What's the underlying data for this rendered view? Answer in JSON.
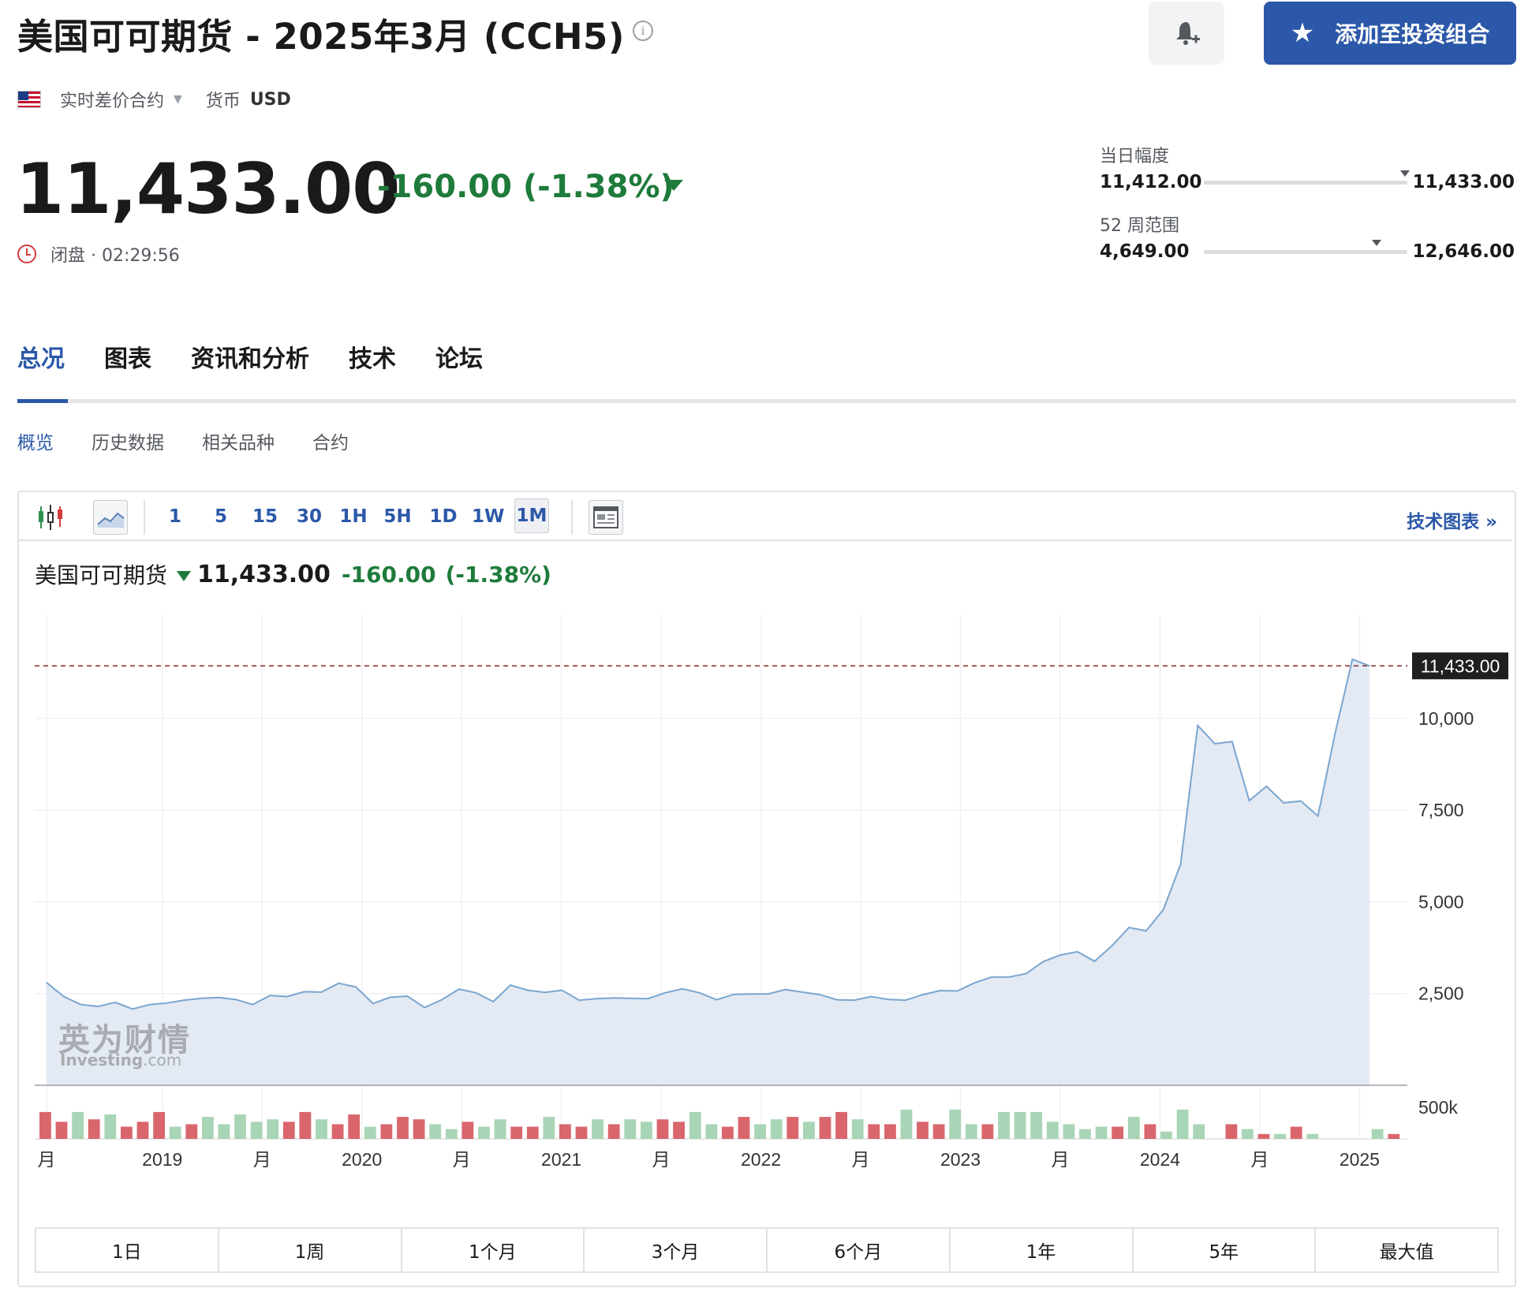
{
  "header": {
    "title": "美国可可期货 - 2025年3月 (CCH5)",
    "info_symbol": "i",
    "alert_icon": "bell-plus-icon",
    "add_button_label": "添加至投资组合",
    "add_button_icon": "star-icon"
  },
  "meta": {
    "flag": "us-flag-icon",
    "contract_type": "实时差价合约",
    "currency_label": "货币",
    "currency_value": "USD"
  },
  "quote": {
    "price": "11,433.00",
    "change": "-160.00 (-1.38%)",
    "direction": "down",
    "status": "闭盘 · 02:29:56",
    "up_color": "#1e7b3b"
  },
  "ranges": {
    "day_label": "当日幅度",
    "day_low": "11,412.00",
    "day_high": "11,433.00",
    "day_position": 0.99,
    "week52_label": "52 周范围",
    "week52_low": "4,649.00",
    "week52_high": "12,646.00",
    "week52_position": 0.85
  },
  "tabs": [
    "总况",
    "图表",
    "资讯和分析",
    "技术",
    "论坛"
  ],
  "active_tab": "总况",
  "subtabs": [
    "概览",
    "历史数据",
    "相关品种",
    "合约"
  ],
  "active_subtab": "概览",
  "toolbar": {
    "intervals": [
      "1",
      "5",
      "15",
      "30",
      "1H",
      "5H",
      "1D",
      "1W",
      "1M"
    ],
    "active_interval": "1M",
    "tech_chart_link": "技术图表 »"
  },
  "chart_header": {
    "name": "美国可可期货",
    "price": "11,433.00",
    "change": "-160.00",
    "change_pct": "(-1.38%)"
  },
  "watermark": {
    "cn": "英为财情",
    "en": "Investing",
    "en_suffix": ".com"
  },
  "chart_data": {
    "type": "area",
    "x_tick_labels": [
      "月",
      "2019",
      "月",
      "2020",
      "月",
      "2021",
      "月",
      "2022",
      "月",
      "2023",
      "月",
      "2024",
      "月",
      "2025"
    ],
    "x_tick_dates": [
      2018.42,
      2019.0,
      2019.5,
      2020.0,
      2020.5,
      2021.0,
      2021.5,
      2022.0,
      2022.5,
      2023.0,
      2023.5,
      2024.0,
      2024.5,
      2025.0
    ],
    "y_ticks": [
      2500,
      5000,
      7500,
      10000
    ],
    "y_tick_labels": [
      "2,500",
      "5,000",
      "7,500",
      "10,000"
    ],
    "ylim": [
      0,
      12600
    ],
    "current_price_label": "11,433.00",
    "current_price": 11433,
    "volume_tick_label": "500k",
    "line_color": "#7aa6cf",
    "fill_color": "#e3eaf4",
    "volume_up_color": "#a8d5b5",
    "volume_down_color": "#d9666c",
    "series": [
      {
        "values": [
          2800,
          2420,
          2200,
          2150,
          2260,
          2080,
          2200,
          2240,
          2320,
          2370,
          2390,
          2340,
          2200,
          2450,
          2420,
          2550,
          2540,
          2780,
          2680,
          2230,
          2400,
          2430,
          2120,
          2330,
          2620,
          2520,
          2280,
          2730,
          2590,
          2530,
          2590,
          2320,
          2360,
          2380,
          2370,
          2360,
          2520,
          2630,
          2520,
          2330,
          2480,
          2490,
          2490,
          2610,
          2540,
          2470,
          2330,
          2320,
          2420,
          2340,
          2320,
          2470,
          2580,
          2570,
          2790,
          2950,
          2950,
          3040,
          3370,
          3550,
          3640,
          3380,
          3800,
          4300,
          4210,
          4790,
          6020,
          9810,
          9310,
          9370,
          7760,
          8150,
          7700,
          7750,
          7340,
          9600,
          11610,
          11433
        ]
      }
    ],
    "volume": [
      {
        "v": 0.55,
        "up": false
      },
      {
        "v": 0.35,
        "up": false
      },
      {
        "v": 0.55,
        "up": true
      },
      {
        "v": 0.4,
        "up": false
      },
      {
        "v": 0.5,
        "up": true
      },
      {
        "v": 0.25,
        "up": false
      },
      {
        "v": 0.35,
        "up": false
      },
      {
        "v": 0.55,
        "up": false
      },
      {
        "v": 0.25,
        "up": true
      },
      {
        "v": 0.3,
        "up": false
      },
      {
        "v": 0.45,
        "up": true
      },
      {
        "v": 0.3,
        "up": true
      },
      {
        "v": 0.5,
        "up": true
      },
      {
        "v": 0.35,
        "up": true
      },
      {
        "v": 0.4,
        "up": true
      },
      {
        "v": 0.35,
        "up": false
      },
      {
        "v": 0.55,
        "up": false
      },
      {
        "v": 0.4,
        "up": true
      },
      {
        "v": 0.3,
        "up": false
      },
      {
        "v": 0.5,
        "up": false
      },
      {
        "v": 0.25,
        "up": true
      },
      {
        "v": 0.3,
        "up": false
      },
      {
        "v": 0.45,
        "up": false
      },
      {
        "v": 0.4,
        "up": false
      },
      {
        "v": 0.3,
        "up": true
      },
      {
        "v": 0.2,
        "up": true
      },
      {
        "v": 0.35,
        "up": false
      },
      {
        "v": 0.25,
        "up": true
      },
      {
        "v": 0.4,
        "up": true
      },
      {
        "v": 0.25,
        "up": false
      },
      {
        "v": 0.25,
        "up": false
      },
      {
        "v": 0.45,
        "up": true
      },
      {
        "v": 0.3,
        "up": false
      },
      {
        "v": 0.25,
        "up": false
      },
      {
        "v": 0.4,
        "up": true
      },
      {
        "v": 0.3,
        "up": false
      },
      {
        "v": 0.4,
        "up": true
      },
      {
        "v": 0.35,
        "up": true
      },
      {
        "v": 0.4,
        "up": false
      },
      {
        "v": 0.35,
        "up": false
      },
      {
        "v": 0.55,
        "up": true
      },
      {
        "v": 0.3,
        "up": true
      },
      {
        "v": 0.25,
        "up": false
      },
      {
        "v": 0.45,
        "up": false
      },
      {
        "v": 0.3,
        "up": true
      },
      {
        "v": 0.4,
        "up": true
      },
      {
        "v": 0.45,
        "up": false
      },
      {
        "v": 0.35,
        "up": true
      },
      {
        "v": 0.45,
        "up": false
      },
      {
        "v": 0.55,
        "up": false
      },
      {
        "v": 0.4,
        "up": true
      },
      {
        "v": 0.3,
        "up": false
      },
      {
        "v": 0.3,
        "up": false
      },
      {
        "v": 0.6,
        "up": true
      },
      {
        "v": 0.35,
        "up": false
      },
      {
        "v": 0.3,
        "up": false
      },
      {
        "v": 0.6,
        "up": true
      },
      {
        "v": 0.3,
        "up": true
      },
      {
        "v": 0.3,
        "up": false
      },
      {
        "v": 0.55,
        "up": true
      },
      {
        "v": 0.55,
        "up": true
      },
      {
        "v": 0.55,
        "up": true
      },
      {
        "v": 0.35,
        "up": true
      },
      {
        "v": 0.3,
        "up": true
      },
      {
        "v": 0.2,
        "up": true
      },
      {
        "v": 0.25,
        "up": true
      },
      {
        "v": 0.25,
        "up": false
      },
      {
        "v": 0.45,
        "up": true
      },
      {
        "v": 0.3,
        "up": false
      },
      {
        "v": 0.15,
        "up": true
      },
      {
        "v": 0.6,
        "up": true
      },
      {
        "v": 0.3,
        "up": true
      },
      {
        "v": 0.0,
        "up": true
      },
      {
        "v": 0.3,
        "up": false
      },
      {
        "v": 0.2,
        "up": true
      },
      {
        "v": 0.1,
        "up": false
      },
      {
        "v": 0.1,
        "up": true
      },
      {
        "v": 0.25,
        "up": false
      },
      {
        "v": 0.1,
        "up": true
      },
      {
        "v": 0.0,
        "up": true
      },
      {
        "v": 0.0,
        "up": true
      },
      {
        "v": 0.0,
        "up": true
      },
      {
        "v": 0.2,
        "up": true
      },
      {
        "v": 0.1,
        "up": false
      }
    ]
  },
  "periods": [
    "1日",
    "1周",
    "1个月",
    "3个月",
    "6个月",
    "1年",
    "5年",
    "最大值"
  ]
}
